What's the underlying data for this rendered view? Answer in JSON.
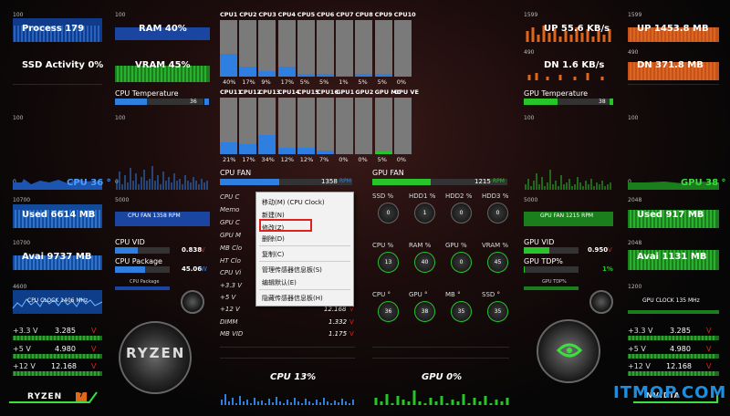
{
  "left": {
    "process": "Process 179",
    "ssd": "SSD Activity 0%",
    "ram": "RAM 40%",
    "vram": "VRAM 45%",
    "cpu_temp_label": "CPU Temperature",
    "cpu_temp_val": "36",
    "cpu_temp_pct": 36,
    "cpu_main": "CPU 36 °",
    "s100a": "100",
    "s100b": "100",
    "s100c": "100",
    "s0": "0",
    "s0b": "0",
    "s0c": "0",
    "used": "Used 6614 MB",
    "avai": "Avai 9737 MB",
    "s10700": "10700",
    "s10700b": "10700",
    "s5000": "5000",
    "s4600": "4600",
    "fan_label": "CPU FAN 1358 RPM",
    "vid_label": "CPU VID",
    "vid_val": "0.838",
    "vid_unit": "V",
    "vid_pct": 42,
    "pkg_label": "CPU Package",
    "pkg_val": "45.06",
    "pkg_unit": "W",
    "pkg_pct": 55,
    "pkg_small": "CPU Package",
    "clock_label": "CPU CLOCK 1406 MHz",
    "v33_l": "+3.3 V",
    "v33_v": "3.285",
    "v5_l": "+5 V",
    "v5_v": "4.980",
    "v12_l": "+12 V",
    "v12_v": "12.168",
    "vunit": "V",
    "brand": "RYZEN",
    "brand2": "RYZEN",
    "badge": "7"
  },
  "cores_top": [
    "CPU1",
    "CPU2",
    "CPU3",
    "CPU4",
    "CPU5",
    "CPU6",
    "CPU7",
    "CPU8",
    "CPU9",
    "CPU10"
  ],
  "cores_top_vals": [
    "40%",
    "17%",
    "9%",
    "17%",
    "5%",
    "5%",
    "1%",
    "5%",
    "5%",
    "0%"
  ],
  "cores_top_pct": [
    40,
    17,
    9,
    17,
    5,
    5,
    1,
    5,
    5,
    0
  ],
  "cores_bot": [
    "CPU11",
    "CPU12",
    "CPU13",
    "CPU14",
    "CPU15",
    "CPU16",
    "GPU1",
    "GPU2",
    "GPU MC",
    "GPU VE"
  ],
  "cores_bot_vals": [
    "21%",
    "17%",
    "34%",
    "12%",
    "12%",
    "7%",
    "0%",
    "0%",
    "5%",
    "0%"
  ],
  "cores_bot_pct": [
    21,
    17,
    34,
    12,
    12,
    7,
    0,
    0,
    5,
    0
  ],
  "center": {
    "cpu_fan": "CPU FAN",
    "cpu_fan_val": "1358",
    "cpu_fan_unit": "RPM",
    "cpu_fan_pct": 45,
    "gpu_fan": "GPU FAN",
    "gpu_fan_val": "1215",
    "gpu_fan_unit": "RPM",
    "gpu_fan_pct": 43,
    "r1": "CPU C",
    "r2": "Memo",
    "r3": "GPU C",
    "r4": "GPU M",
    "r5": "MB Clo",
    "r6": "HT Clo",
    "r7": "CPU Vi",
    "r8": "+3.3 V",
    "r9": "+5 V",
    "r10": "+12 V",
    "r10v": "12.168",
    "r11": "DIMM",
    "r11v": "1.332",
    "r12": "MB VID",
    "r12v": "1.175",
    "vu": "V",
    "cpu_pct": "CPU 13%",
    "gpu_pct": "GPU  0%",
    "g1": [
      "SSD %",
      "HDD1 %",
      "HDD2 %",
      "HDD3 %"
    ],
    "g1v": [
      "0",
      "1",
      "0",
      "0"
    ],
    "g2": [
      "CPU %",
      "RAM %",
      "GPU %",
      "VRAM %"
    ],
    "g2v": [
      "13",
      "40",
      "0",
      "45"
    ],
    "g3": [
      "CPU °",
      "GPU °",
      "MB °",
      "SSD °"
    ],
    "g3v": [
      "36",
      "38",
      "35",
      "35"
    ]
  },
  "menu": {
    "i1": "移动(M) (CPU Clock)",
    "i2": "新建(N)",
    "i3": "修改(Z)",
    "i4": "删除(D)",
    "i5": "复制(C)",
    "i6": "管理传感器信息板(S)",
    "i7": "编辑默认(E)",
    "i8": "隐藏传感器信息板(H)"
  },
  "right": {
    "up": "UP 55.6 KB/s",
    "dn": "DN 1.6 KB/s",
    "up2": "UP 1453.8 MB",
    "dn2": "DN 371.8 MB",
    "r1599": "1599",
    "r1599b": "1599",
    "r100": "100",
    "r490": "490",
    "r490b": "490",
    "r0": "0",
    "gpu_temp_label": "GPU Temperature",
    "gpu_temp_val": "38",
    "gpu_temp_pct": 38,
    "gpu_main": "GPU 38 °",
    "used": "Used 917 MB",
    "avai": "Avai 1131 MB",
    "s5000": "5000",
    "s2048": "2048",
    "s2048b": "2048",
    "s1200": "1200",
    "fan_label": "GPU FAN 1215 RPM",
    "vid_label": "GPU VID",
    "vid_val": "0.950",
    "vid_unit": "V",
    "vid_pct": 46,
    "tdp_label": "GPU TDP%",
    "tdp_val": "1%",
    "tdp_pct": 1,
    "tdp_small": "GPU TDP%",
    "clock_label": "GPU CLOCK 135 MHz",
    "v33_l": "+3.3 V",
    "v33_v": "3.285",
    "v5_l": "+5 V",
    "v5_v": "4.980",
    "v12_l": "+12 V",
    "v12_v": "12.168",
    "vunit": "V",
    "brand": "NVIDIA",
    "watermark": "ITMOP.COM"
  },
  "colors": {
    "blue": "#2f7fe0",
    "green": "#27c42a",
    "orange": "#e0661a",
    "red": "#e0201c"
  }
}
